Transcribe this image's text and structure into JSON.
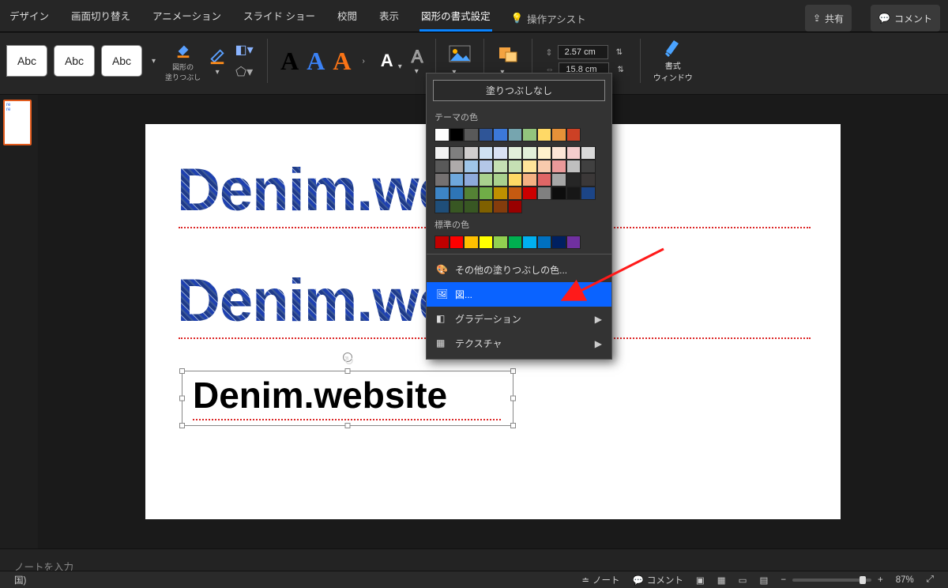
{
  "tabs": {
    "design": "デザイン",
    "transition": "画面切り替え",
    "animation": "アニメーション",
    "slideshow": "スライド ショー",
    "review": "校閲",
    "view": "表示",
    "shapeFormat": "図形の書式設定",
    "assist": "操作アシスト",
    "share": "共有",
    "comment": "コメント"
  },
  "ribbon": {
    "abc": "Abc",
    "shapeFill": "図形の\n塗りつぶし",
    "size_h": "2.57 cm",
    "size_w": "15.8 cm",
    "formatPane": "書式\nウィンドウ"
  },
  "popup": {
    "nofill": "塗りつぶしなし",
    "themeColors": "テーマの色",
    "standardColors": "標準の色",
    "moreFill": "その他の塗りつぶしの色...",
    "picture": "図...",
    "gradient": "グラデーション",
    "texture": "テクスチャ",
    "themeRow1": [
      "#ffffff",
      "#000000",
      "#595959",
      "#2f5597",
      "#3c78d8",
      "#76a5af",
      "#93c47d",
      "#ffd966",
      "#e69138",
      "#cc4125"
    ],
    "themeShades": [
      [
        "#f2f2f2",
        "#7f7f7f",
        "#d0cece",
        "#cfe2f3",
        "#d9e2f3",
        "#e2efda",
        "#e2f0d9",
        "#fff2cc",
        "#fbe5d6",
        "#f4cccc"
      ],
      [
        "#d9d9d9",
        "#595959",
        "#aeaaaa",
        "#9fc5e8",
        "#b4c7e7",
        "#c5e0b4",
        "#c5e0b4",
        "#ffe599",
        "#f8cbad",
        "#ea9999"
      ],
      [
        "#bfbfbf",
        "#404040",
        "#757171",
        "#6fa8dc",
        "#8eaadb",
        "#a9d18e",
        "#a9d18e",
        "#ffd966",
        "#f4b183",
        "#e06666"
      ],
      [
        "#a6a6a6",
        "#262626",
        "#3b3838",
        "#3d85c6",
        "#2e75b6",
        "#548235",
        "#70ad47",
        "#bf9000",
        "#c55a11",
        "#cc0000"
      ],
      [
        "#808080",
        "#0d0d0d",
        "#171717",
        "#1c4587",
        "#1f4e79",
        "#385723",
        "#385723",
        "#7f6000",
        "#843c0c",
        "#990000"
      ]
    ],
    "standard": [
      "#c00000",
      "#ff0000",
      "#ffc000",
      "#ffff00",
      "#92d050",
      "#00b050",
      "#00b0f0",
      "#0070c0",
      "#002060",
      "#7030a0"
    ]
  },
  "slide": {
    "text": "Denim.website"
  },
  "thumb": {
    "text": "re\nre"
  },
  "notes": {
    "placeholder": "ノートを入力"
  },
  "status": {
    "lang": "国)",
    "notes": "ノート",
    "comments": "コメント",
    "zoom": "87%"
  }
}
